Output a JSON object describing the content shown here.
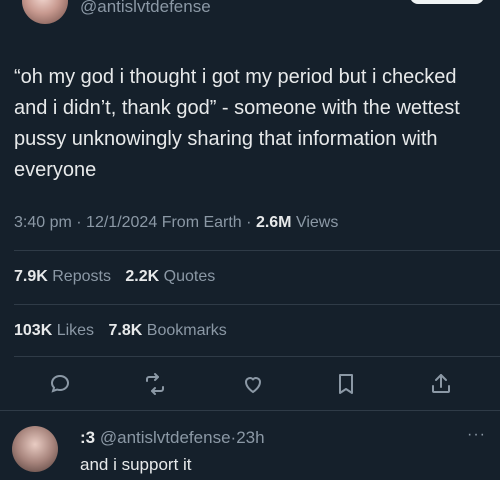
{
  "author": {
    "handle": "@antislvtdefense"
  },
  "tweet": {
    "text": "“oh my god i thought i got my period but i checked and i didn’t, thank god” - someone with the wettest pussy unknowingly sharing that information with everyone",
    "time": "3:40 pm",
    "date": "12/1/2024",
    "source": "From Earth",
    "views_count": "2.6M",
    "views_label": "Views"
  },
  "stats": {
    "reposts_count": "7.9K",
    "reposts_label": "Reposts",
    "quotes_count": "2.2K",
    "quotes_label": "Quotes",
    "likes_count": "103K",
    "likes_label": "Likes",
    "bookmarks_count": "7.8K",
    "bookmarks_label": "Bookmarks"
  },
  "actions": [
    "reply-icon",
    "repost-icon",
    "like-icon",
    "bookmark-icon",
    "share-icon"
  ],
  "reply": {
    "name": ":3",
    "handle": "@antislvtdefense",
    "time": "23h",
    "text": "and i support it",
    "more": "···"
  },
  "colors": {
    "background": "#15202b",
    "text": "#e7e9ea",
    "muted": "#8b98a5",
    "divider": "#2f3b47"
  }
}
